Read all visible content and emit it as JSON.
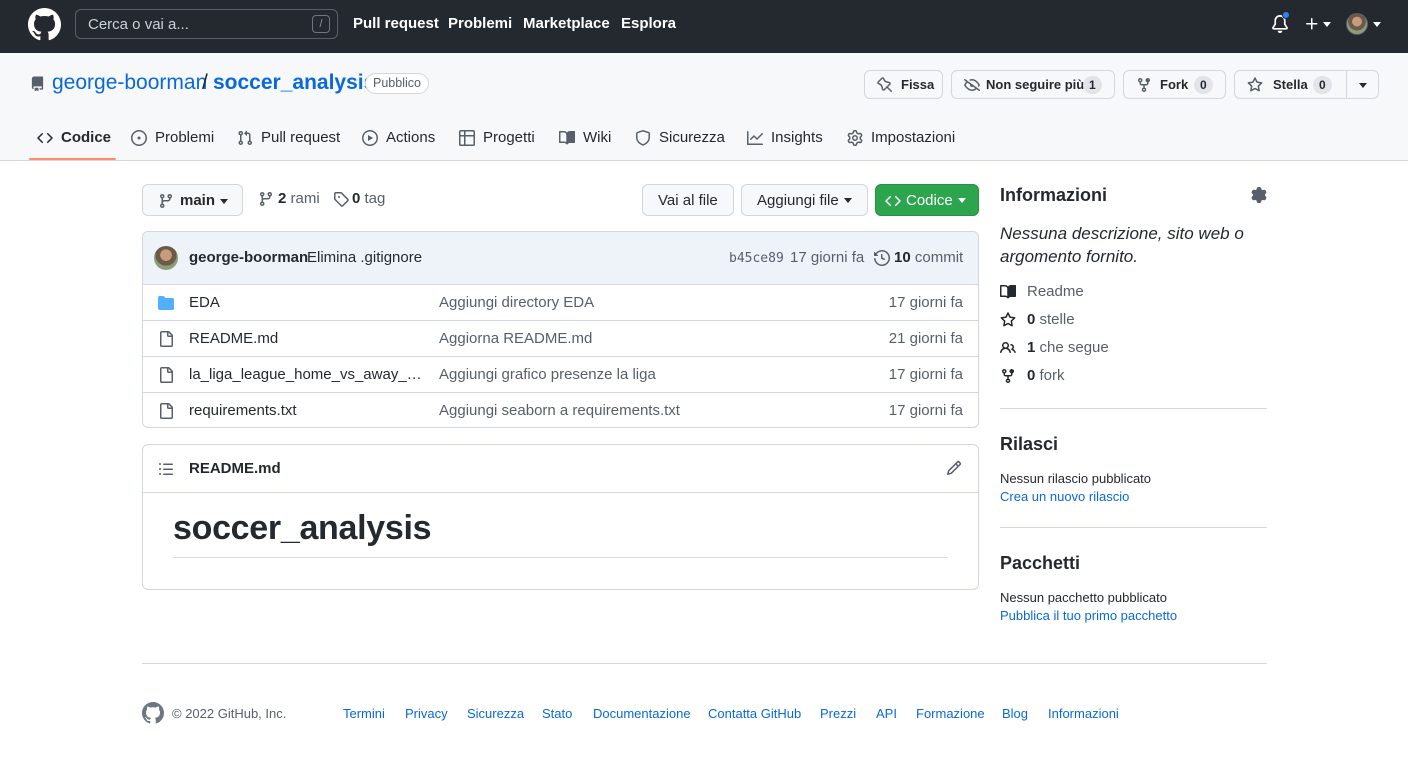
{
  "header": {
    "search_placeholder": "Cerca o vai a...",
    "search_shortcut": "/",
    "nav": [
      "Pull request",
      "Problemi",
      "Marketplace",
      "Esplora"
    ]
  },
  "repo": {
    "owner": "george-boorman",
    "separator": "/",
    "name": "soccer_analysis",
    "visibility": "Pubblico",
    "actions": {
      "pin_label": "Fissa",
      "watch_label": "Non seguire più",
      "watch_count": "1",
      "fork_label": "Fork",
      "fork_count": "0",
      "star_label": "Stella",
      "star_count": "0"
    },
    "tabs": [
      "Codice",
      "Problemi",
      "Pull request",
      "Actions",
      "Progetti",
      "Wiki",
      "Sicurezza",
      "Insights",
      "Impostazioni"
    ],
    "active_tab": "Codice"
  },
  "toolbar": {
    "branch": "main",
    "branches_count": "2",
    "branches_label": "rami",
    "tags_count": "0",
    "tags_label": "tag",
    "goto_file": "Vai al file",
    "add_file": "Aggiungi file",
    "code": "Codice"
  },
  "commit": {
    "author": "george-boorman",
    "message": "Elimina .gitignore",
    "sha": "b45ce89",
    "age": "17 giorni fa",
    "count": "10",
    "count_label": "commit"
  },
  "files": [
    {
      "type": "dir",
      "name": "EDA",
      "message": "Aggiungi directory EDA",
      "age": "17 giorni fa"
    },
    {
      "type": "file",
      "name": "README.md",
      "message": "Aggiorna README.md",
      "age": "21 giorni fa"
    },
    {
      "type": "file",
      "name": "la_liga_league_home_vs_away_att…",
      "message": "Aggiungi grafico presenze la liga",
      "age": "17 giorni fa"
    },
    {
      "type": "file",
      "name": "requirements.txt",
      "message": "Aggiungi seaborn a requirements.txt",
      "age": "17 giorni fa"
    }
  ],
  "readme": {
    "filename": "README.md",
    "heading": "soccer_analysis"
  },
  "sidebar": {
    "about_title": "Informazioni",
    "description": "Nessuna descrizione, sito web o argomento fornito.",
    "readme_label": "Readme",
    "stars_count": "0",
    "stars_label": "stelle",
    "watching_count": "1",
    "watching_label": "che segue",
    "forks_count": "0",
    "forks_label": "fork",
    "releases_title": "Rilasci",
    "releases_empty": "Nessun rilascio pubblicato",
    "releases_link": "Crea un nuovo rilascio",
    "packages_title": "Pacchetti",
    "packages_empty": "Nessun pacchetto pubblicato",
    "packages_link": "Pubblica il tuo primo pacchetto"
  },
  "footer": {
    "copyright": "© 2022 GitHub, Inc.",
    "links": [
      "Termini",
      "Privacy",
      "Sicurezza",
      "Stato",
      "Documentazione",
      "Contatta GitHub",
      "Prezzi",
      "API",
      "Formazione",
      "Blog",
      "Informazioni"
    ]
  },
  "colors": {
    "header_bg": "#24292f",
    "link": "#0969da",
    "code_button": "#2da44e",
    "active_tab_underline": "#fd8c73",
    "folder": "#54aeff"
  }
}
